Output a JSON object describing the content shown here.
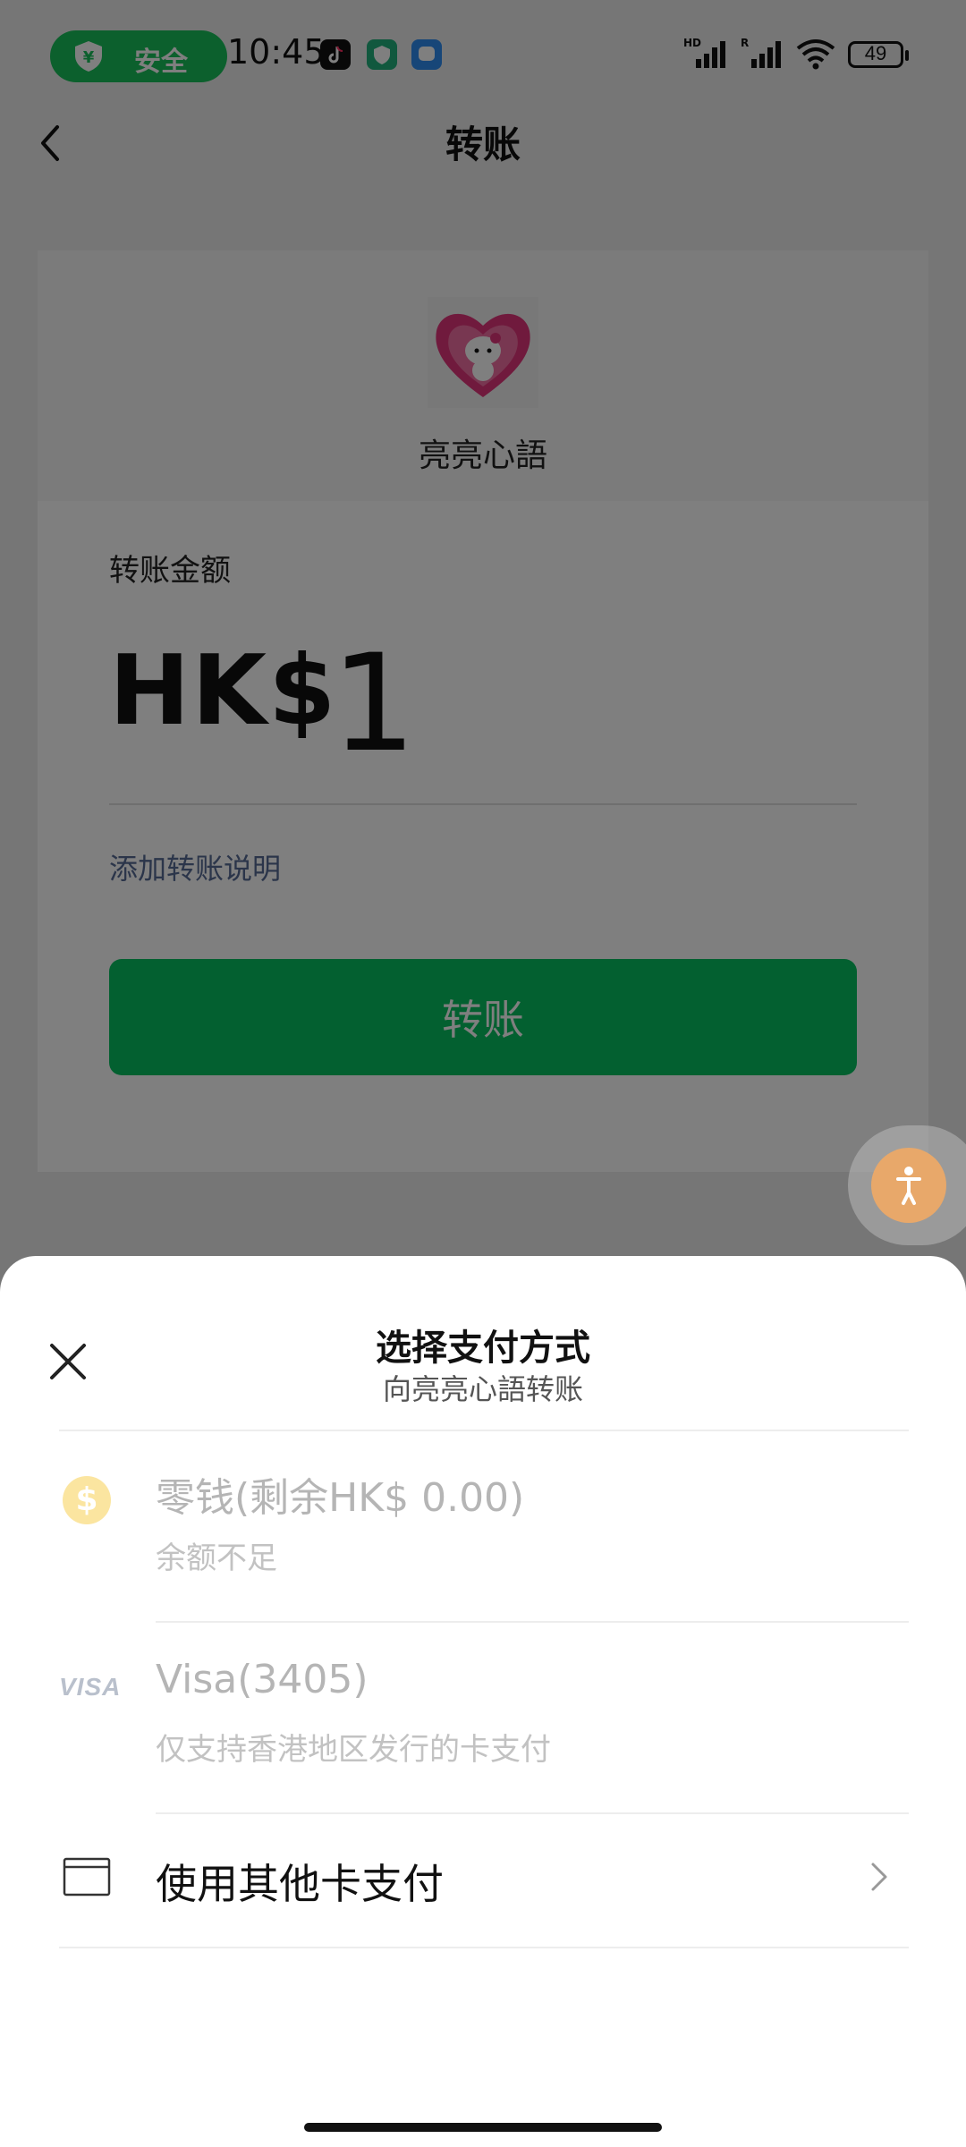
{
  "status_bar": {
    "safety_label": "安全",
    "time": "10:45",
    "battery": "49",
    "network_labels": [
      "HD",
      "R"
    ]
  },
  "nav": {
    "title": "转账"
  },
  "recipient": {
    "name": "亮亮心語"
  },
  "amount_card": {
    "label": "转账金额",
    "currency": "HK$",
    "amount": "1",
    "add_note": "添加转账说明",
    "button_label": "转账"
  },
  "sheet": {
    "title": "选择支付方式",
    "subtitle": "向亮亮心語转账",
    "options": [
      {
        "icon": "coin-icon",
        "symbol": "$",
        "title": "零钱(剩余HK$ 0.00)",
        "subtitle": "余额不足",
        "enabled": false
      },
      {
        "icon": "visa-icon",
        "symbol": "VISA",
        "title": "Visa(3405)",
        "subtitle": "仅支持香港地区发行的卡支付",
        "enabled": false
      }
    ],
    "other_card": "使用其他卡支付"
  },
  "colors": {
    "brand_green": "#07c160",
    "link_blue": "#576b95",
    "safety_green": "#19c15a"
  }
}
